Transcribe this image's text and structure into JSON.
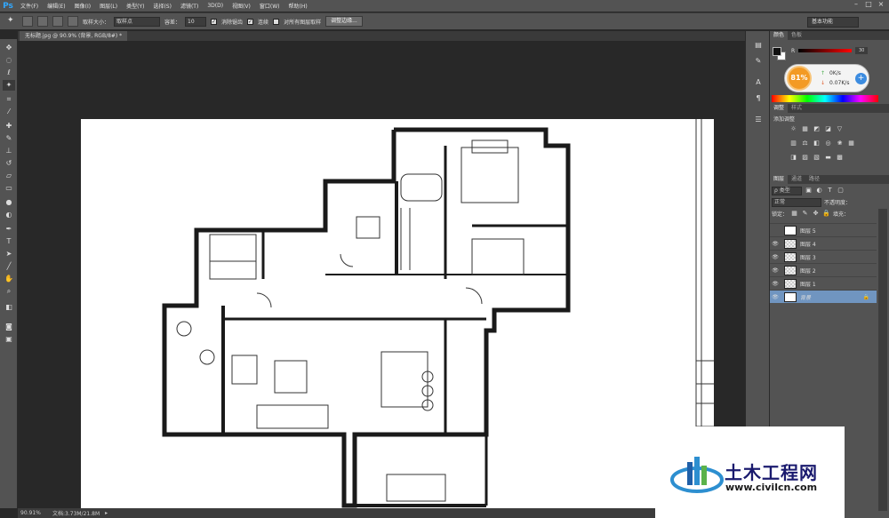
{
  "app": {
    "logo": "Ps"
  },
  "menubar": {
    "items": [
      "文件(F)",
      "编辑(E)",
      "图像(I)",
      "图层(L)",
      "类型(Y)",
      "选择(S)",
      "滤镜(T)",
      "3D(D)",
      "视图(V)",
      "窗口(W)",
      "帮助(H)"
    ],
    "window_controls": [
      "–",
      "□",
      "×"
    ]
  },
  "options": {
    "sample_size_label": "取样大小：",
    "sample_size_value": "取样点",
    "tolerance_label": "容差：",
    "tolerance_value": "10",
    "antialias_label": "消除锯齿",
    "contiguous_label": "连续",
    "sample_all_label": "对所有图层取样",
    "refine_button": "调整边缘...",
    "workspace": "基本功能"
  },
  "document": {
    "tab_title": "无标题.jpg @ 90.9% (背景, RGB/8#) *"
  },
  "status": {
    "zoom": "90.91%",
    "doc_info": "文档:3.73M/21.8M"
  },
  "panels": {
    "color_tabs": [
      "颜色",
      "色板"
    ],
    "color_r_label": "R",
    "color_r_value": "30",
    "speed": {
      "percent": "81%",
      "up": "0K/s",
      "down": "0.07K/s",
      "plus": "+"
    },
    "adjust_tabs": [
      "调整",
      "样式"
    ],
    "adjust_title": "添加调整",
    "layers_tabs": [
      "图层",
      "通道",
      "路径"
    ],
    "kind_filter": "ρ 类型",
    "blend_mode": "正常",
    "opacity_label": "不透明度：",
    "lock_label": "锁定：",
    "fill_label": "填充：",
    "layers": [
      {
        "name": "图层 5",
        "visible": false
      },
      {
        "name": "图层 4",
        "visible": true
      },
      {
        "name": "图层 3",
        "visible": true
      },
      {
        "name": "图层 2",
        "visible": true
      },
      {
        "name": "图层 1",
        "visible": true
      },
      {
        "name": "背景",
        "visible": true
      }
    ]
  },
  "watermark": {
    "name": "土木工程网",
    "url": "www.civilcn.com"
  },
  "colors": {
    "accent": "#31a8ff",
    "layer_selected": "#7095c0",
    "speed_orange": "#f39a24"
  }
}
